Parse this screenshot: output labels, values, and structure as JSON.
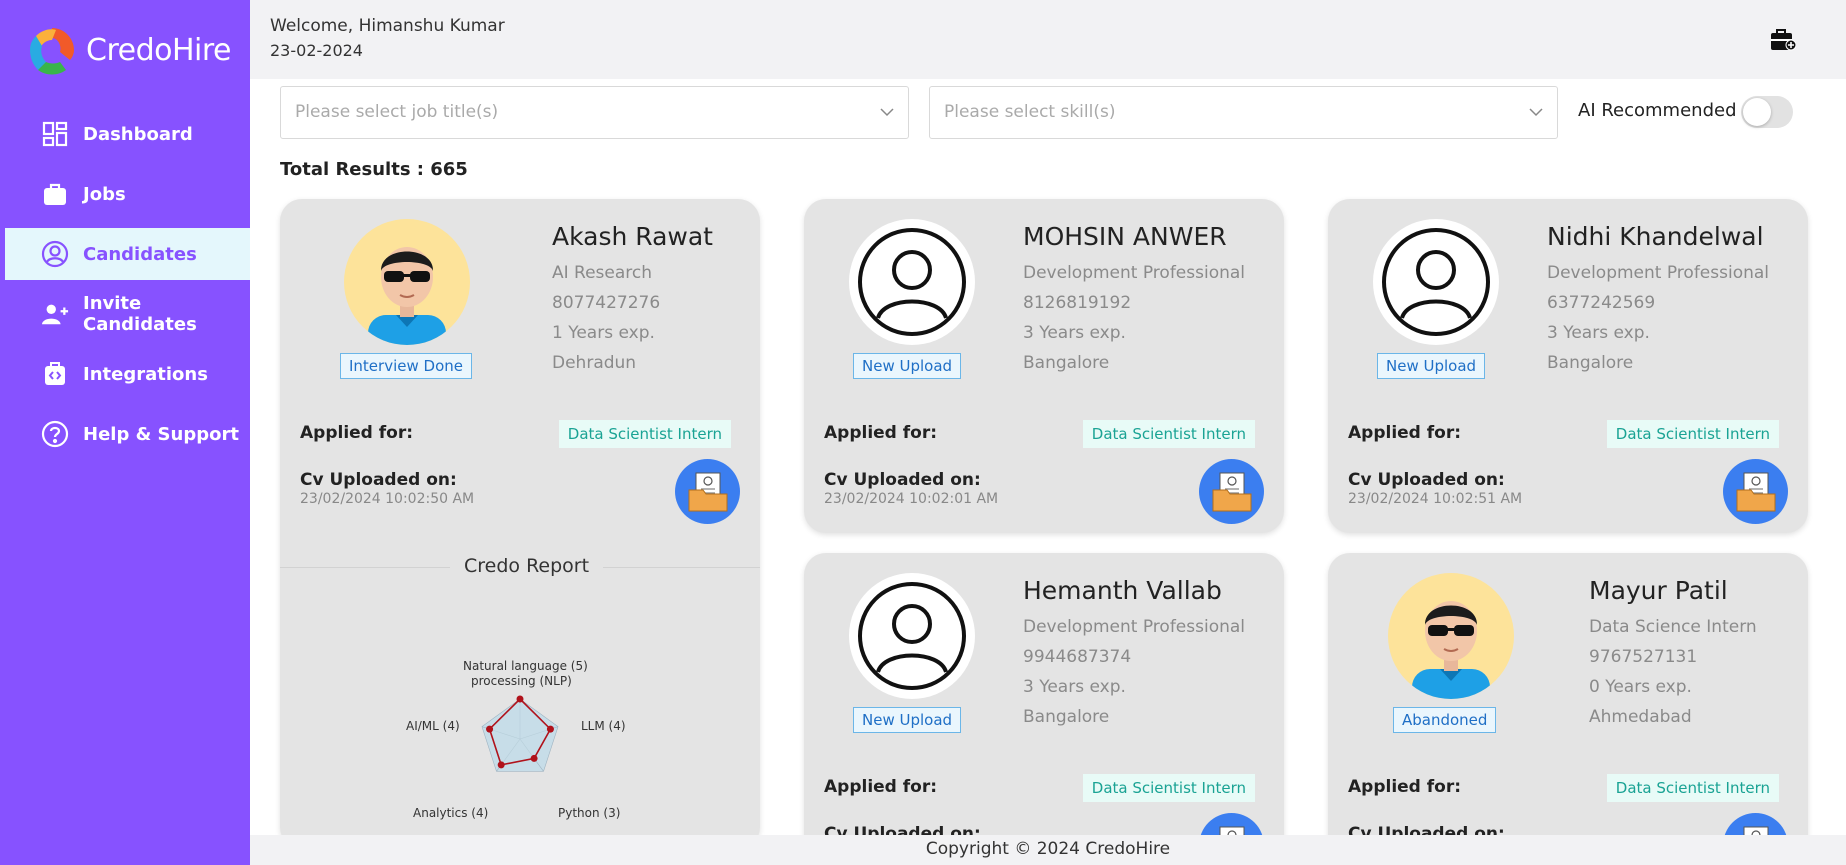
{
  "app": {
    "name": "CredoHire"
  },
  "sidebar": {
    "items": [
      {
        "label": "Dashboard",
        "icon": "dashboard-icon"
      },
      {
        "label": "Jobs",
        "icon": "briefcase-icon"
      },
      {
        "label": "Candidates",
        "icon": "user-circle-icon",
        "active": true
      },
      {
        "label": "Invite Candidates",
        "icon": "add-user-icon"
      },
      {
        "label": "Integrations",
        "icon": "integrations-icon"
      },
      {
        "label": "Help & Support",
        "icon": "help-icon"
      }
    ]
  },
  "header": {
    "welcome": "Welcome, Himanshu Kumar",
    "date": "23-02-2024",
    "icon": "briefcase-plus-icon"
  },
  "filters": {
    "job_placeholder": "Please select job title(s)",
    "skill_placeholder": "Please select skill(s)",
    "ai_label": "AI Recommended",
    "ai_enabled": false
  },
  "results": {
    "total_label": "Total Results : 665"
  },
  "labels": {
    "applied_for": "Applied for:",
    "cv_uploaded": "Cv Uploaded on:",
    "credo_report": "Credo Report"
  },
  "candidates": [
    {
      "name": "Akash Rawat",
      "role": "AI Research",
      "phone": "8077427276",
      "experience": "1 Years exp.",
      "location": "Dehradun",
      "status": "Interview Done",
      "job": "Data Scientist Intern",
      "cv_date": "23/02/2024 10:02:50 AM",
      "avatar": "cartoon-avatar"
    },
    {
      "name": "MOHSIN ANWER",
      "role": "Development Professional",
      "phone": "8126819192",
      "experience": "3 Years exp.",
      "location": "Bangalore",
      "status": "New Upload",
      "job": "Data Scientist Intern",
      "cv_date": "23/02/2024 10:02:01 AM",
      "avatar": "default-user-icon"
    },
    {
      "name": "Nidhi Khandelwal",
      "role": "Development Professional",
      "phone": "6377242569",
      "experience": "3 Years exp.",
      "location": "Bangalore",
      "status": "New Upload",
      "job": "Data Scientist Intern",
      "cv_date": "23/02/2024 10:02:51 AM",
      "avatar": "default-user-icon"
    },
    {
      "name": "Hemanth Vallab",
      "role": "Development Professional",
      "phone": "9944687374",
      "experience": "3 Years exp.",
      "location": "Bangalore",
      "status": "New Upload",
      "job": "Data Scientist Intern",
      "cv_date": "",
      "avatar": "default-user-icon"
    },
    {
      "name": "Mayur Patil",
      "role": "Data Science Intern",
      "phone": "9767527131",
      "experience": "0 Years exp.",
      "location": "Ahmedabad",
      "status": "Abandoned",
      "job": "Data Scientist Intern",
      "cv_date": "",
      "avatar": "cartoon-avatar"
    }
  ],
  "radar": {
    "labels": [
      "Natural language (5)",
      "processing (NLP)",
      "LLM (4)",
      "Python (3)",
      "Analytics (4)",
      "AI/ML (4)"
    ],
    "skills": [
      {
        "name": "Natural language processing (NLP)",
        "score": 5
      },
      {
        "name": "LLM",
        "score": 4
      },
      {
        "name": "Python",
        "score": 3
      },
      {
        "name": "Analytics",
        "score": 4
      },
      {
        "name": "AI/ML",
        "score": 4
      }
    ],
    "max": 5,
    "colors": {
      "line": "#b0121b",
      "fill": "#c7dde8",
      "grid": "#9fb4c2"
    }
  },
  "footer": {
    "text": "Copyright © 2024 CredoHire"
  },
  "colors": {
    "brand": "#8752ff",
    "active_bg": "#e4f7fc",
    "cv_button": "#3b7ef0",
    "job_tag": "#1aa394"
  }
}
